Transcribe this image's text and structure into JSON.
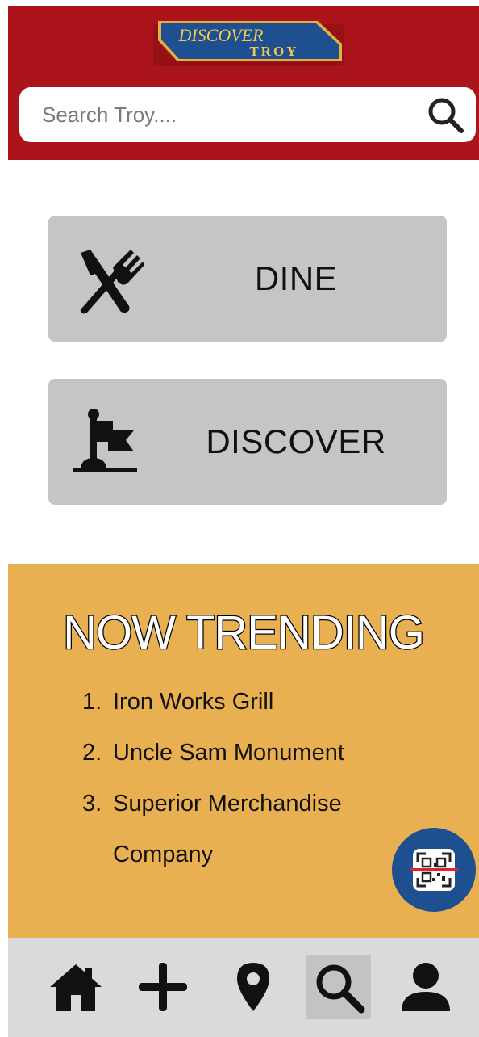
{
  "header": {
    "logo": {
      "line1": "DISCOVER",
      "line2": "TROY"
    },
    "search": {
      "placeholder": "Search Troy....",
      "icon": "search-icon"
    }
  },
  "categories": [
    {
      "label": "DINE",
      "icon": "fork-knife-icon"
    },
    {
      "label": "DISCOVER",
      "icon": "flag-icon"
    }
  ],
  "trending": {
    "title": "NOW TRENDING",
    "items": [
      {
        "num": "1.",
        "name": "Iron Works Grill"
      },
      {
        "num": "2.",
        "name": "Uncle Sam Monument"
      },
      {
        "num": "3.",
        "name": "Superior Merchandise Company"
      }
    ],
    "qr_icon": "qr-scan-icon"
  },
  "nav": [
    {
      "icon": "home-icon"
    },
    {
      "icon": "plus-icon"
    },
    {
      "icon": "map-pin-icon"
    },
    {
      "icon": "search-icon",
      "active": true
    },
    {
      "icon": "user-icon"
    }
  ],
  "colors": {
    "header": "#ab141b",
    "logo_blue": "#1d4f91",
    "logo_gold": "#e3b23c",
    "category_bg": "#c5c5c5",
    "trending_bg": "#e9b052",
    "nav_bg": "#dadada",
    "nav_active": "#c3c3c3"
  }
}
